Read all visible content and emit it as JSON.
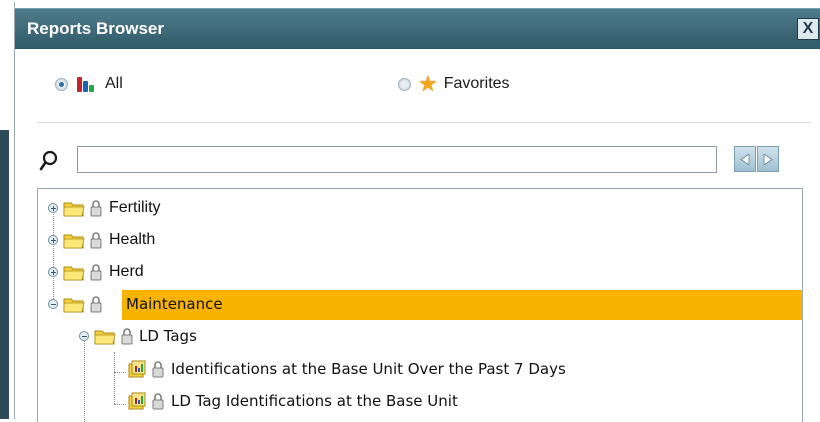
{
  "window": {
    "title": "Reports Browser",
    "close_label": "X"
  },
  "filters": {
    "all_label": "All",
    "all_selected": true,
    "favorites_label": "Favorites",
    "favorites_selected": false
  },
  "search": {
    "value": "",
    "placeholder": ""
  },
  "tree": [
    {
      "label": "Fertility",
      "level": 0,
      "expanded": false,
      "locked": true,
      "type": "folder"
    },
    {
      "label": "Health",
      "level": 0,
      "expanded": false,
      "locked": true,
      "type": "folder"
    },
    {
      "label": "Herd",
      "level": 0,
      "expanded": false,
      "locked": true,
      "type": "folder"
    },
    {
      "label": "Maintenance",
      "level": 0,
      "expanded": true,
      "locked": true,
      "type": "folder",
      "selected": true
    },
    {
      "label": "LD Tags",
      "level": 1,
      "expanded": true,
      "locked": true,
      "type": "folder"
    },
    {
      "label": "Identifications at the Base Unit Over the Past 7 Days",
      "level": 2,
      "locked": true,
      "type": "report"
    },
    {
      "label": "LD Tag Identifications at the Base Unit",
      "level": 2,
      "locked": true,
      "type": "report"
    }
  ],
  "colors": {
    "titlebar": "#2f5a68",
    "selection": "#f7b300",
    "folder": "#f6d23a",
    "star": "#f2a81d"
  },
  "icons": [
    "close-icon",
    "bars-chart-icon",
    "star-icon",
    "search-icon",
    "arrow-left-icon",
    "arrow-right-icon",
    "folder-icon",
    "lock-icon",
    "report-icon",
    "expander-icon"
  ]
}
